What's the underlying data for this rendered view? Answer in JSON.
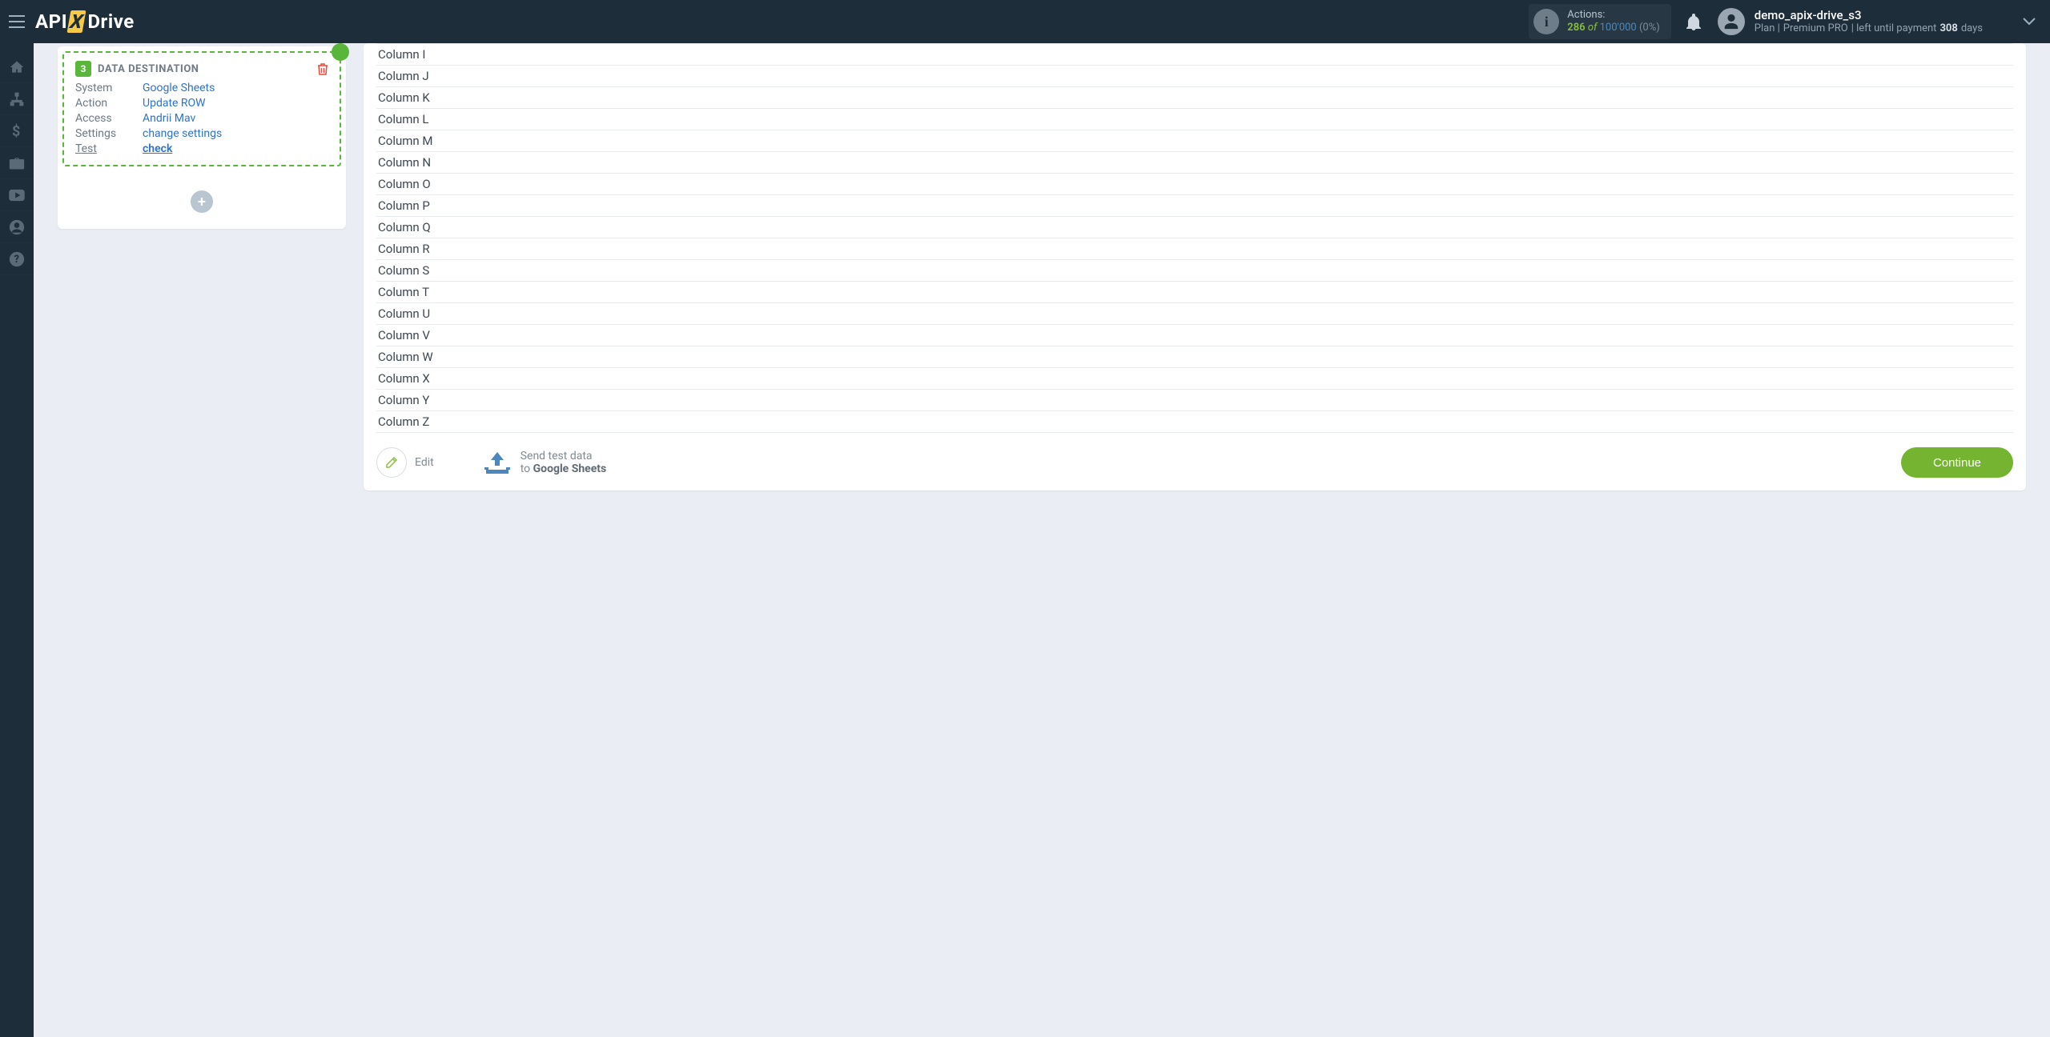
{
  "topbar": {
    "actions_label": "Actions:",
    "actions_count": "286",
    "actions_of": "of",
    "actions_total": "100'000",
    "actions_pct": "(0%)"
  },
  "user": {
    "username": "demo_apix-drive_s3",
    "plan_prefix": "Plan  |",
    "plan_name": "Premium PRO",
    "plan_middle": "|  left until payment",
    "plan_days_num": "308",
    "plan_days_suffix": "days"
  },
  "dest": {
    "badge": "3",
    "title": "DATA DESTINATION",
    "rows": {
      "system_k": "System",
      "system_v": "Google Sheets",
      "action_k": "Action",
      "action_v": "Update ROW",
      "access_k": "Access",
      "access_v": "Andrii Mav",
      "settings_k": "Settings",
      "settings_v": "change settings",
      "test_k": "Test",
      "test_v": "check"
    }
  },
  "columns": [
    "Column I",
    "Column J",
    "Column K",
    "Column L",
    "Column M",
    "Column N",
    "Column O",
    "Column P",
    "Column Q",
    "Column R",
    "Column S",
    "Column T",
    "Column U",
    "Column V",
    "Column W",
    "Column X",
    "Column Y",
    "Column Z"
  ],
  "footer": {
    "edit": "Edit",
    "send_line1": "Send test data",
    "send_line2_prefix": "to ",
    "send_line2_target": "Google Sheets",
    "continue": "Continue"
  }
}
